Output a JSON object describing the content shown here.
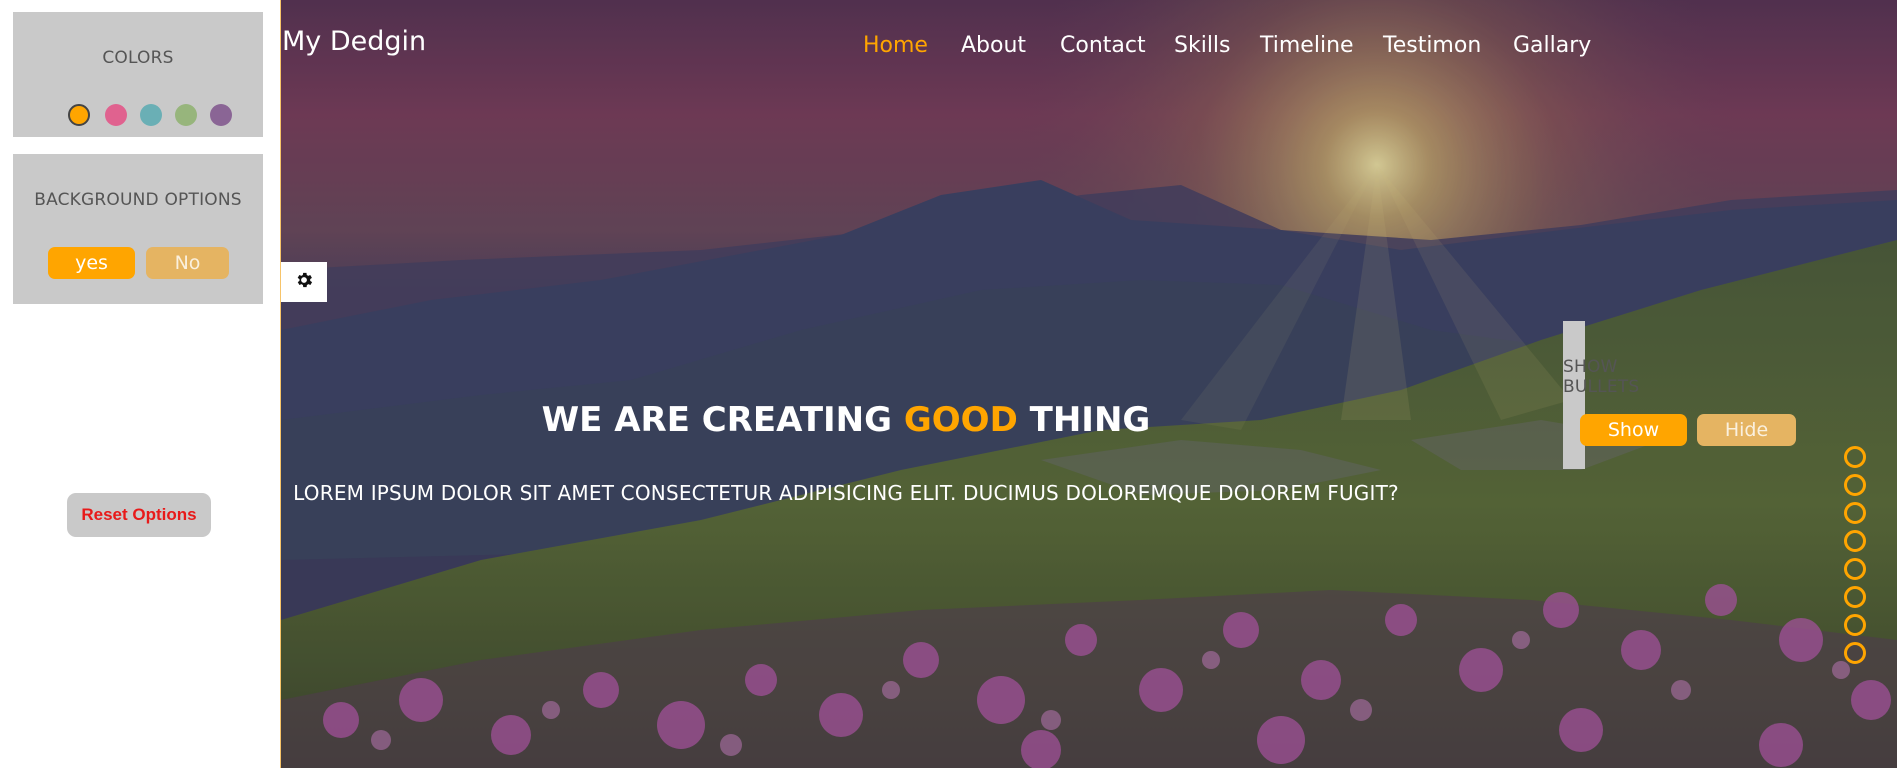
{
  "settings": {
    "colors_title": "COLORS",
    "colors": [
      "#ffa500",
      "#e0628f",
      "#6aafb5",
      "#97b57c",
      "#8a6595"
    ],
    "background_title": "BACKGROUND OPTIONS",
    "background_yes": "yes",
    "background_no": "No",
    "bullets_title": "SHOW BULLETS",
    "bullets_show": "Show",
    "bullets_hide": "Hide",
    "reset_label": "Reset Options"
  },
  "header": {
    "brand": "My Dedgin",
    "nav": [
      "Home",
      "About",
      "Contact",
      "Skills",
      "Timeline",
      "Testimon",
      "Gallary"
    ],
    "active_nav": "Home"
  },
  "hero": {
    "headline_part1": "WE ARE CREATING ",
    "headline_accent": "GOOD",
    "headline_part2": " THING",
    "subtitle": "LOREM IPSUM DOLOR SIT AMET CONSECTETUR ADIPISICING ELIT. DUCIMUS DOLOREMQUE DOLOREM FUGIT?"
  },
  "accent_color": "#ffa500",
  "icons": {
    "settings_toggle": "gear-icon"
  }
}
